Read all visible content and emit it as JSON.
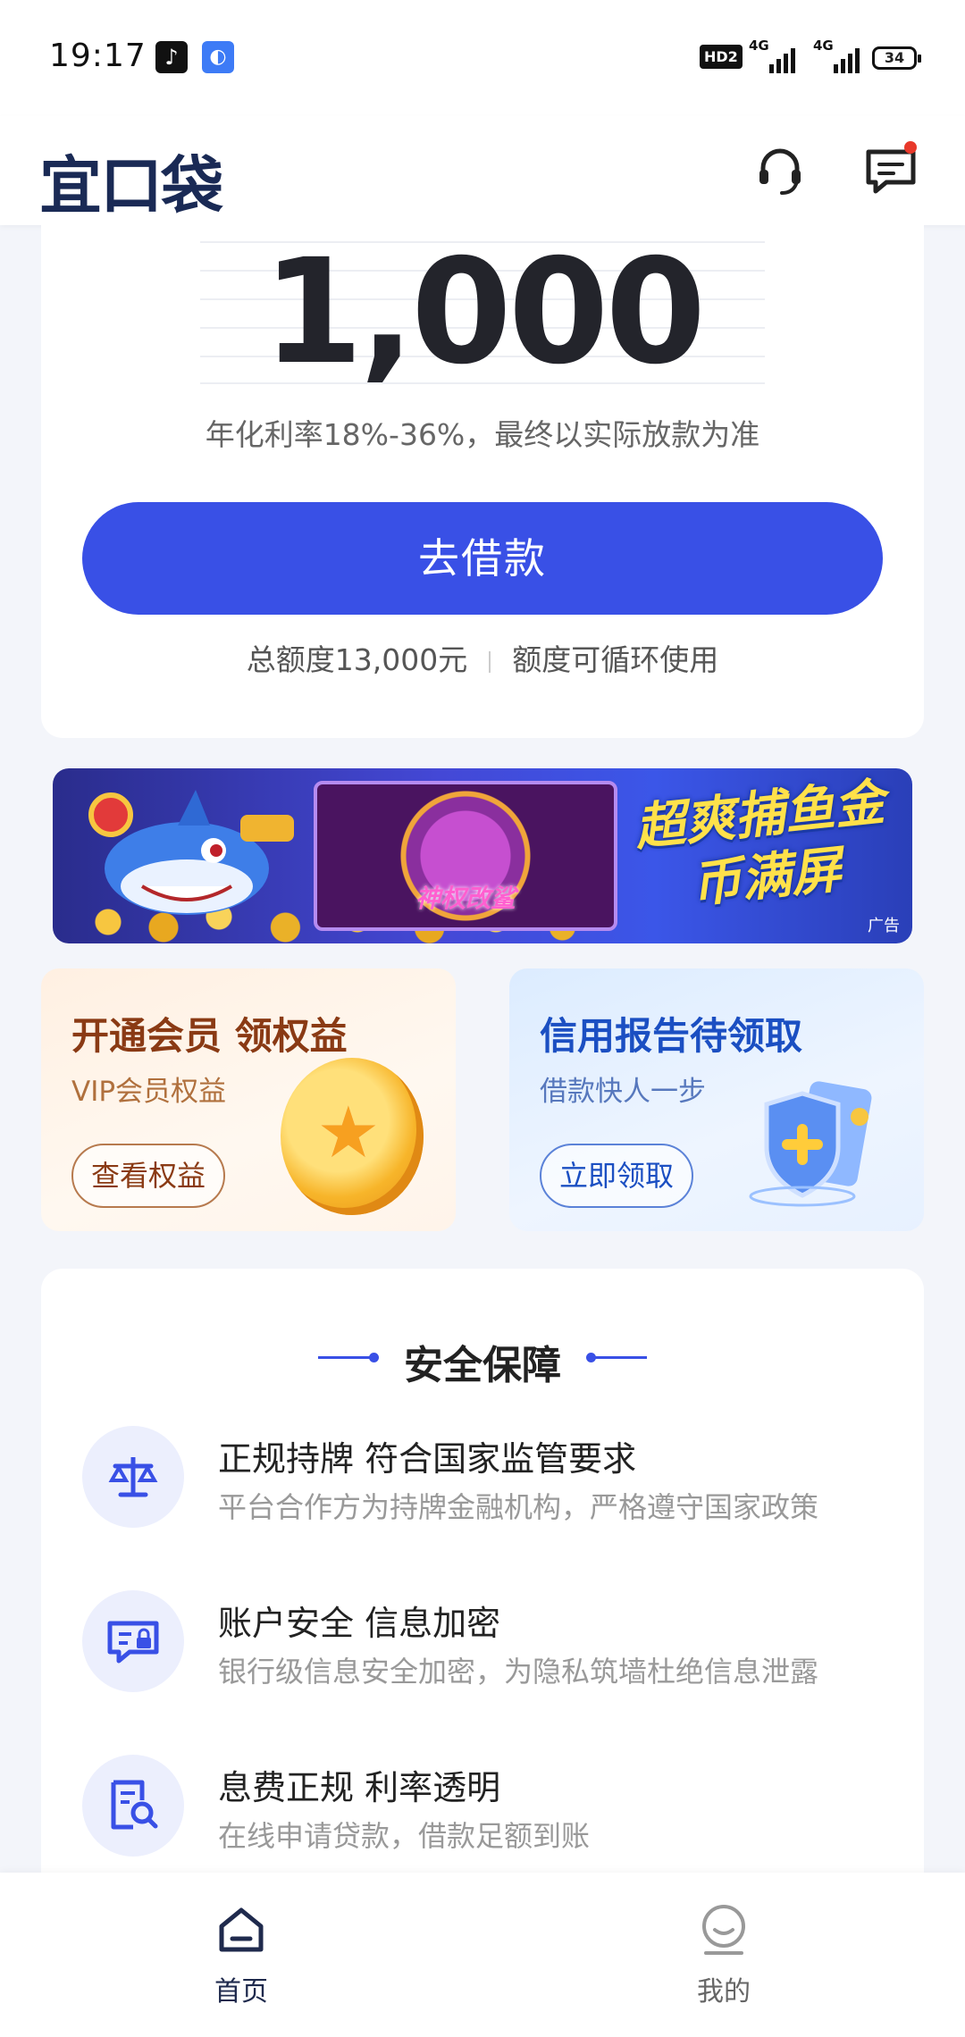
{
  "status_bar": {
    "time": "19:17",
    "hd_badge": "HD2",
    "network_1": "4G",
    "network_2": "4G",
    "battery": "34"
  },
  "header": {
    "logo": "宜口袋",
    "icons": [
      "headset-icon",
      "message-icon"
    ],
    "has_unread_dot": true
  },
  "loan": {
    "amount": "1,000",
    "rate_note": "年化利率18%-36%，最终以实际放款为准",
    "borrow_button": "去借款",
    "total_quota": "总额度13,000元",
    "quota_note": "额度可循环使用"
  },
  "ad_banner": {
    "title": "超爽捕鱼金币满屏",
    "screen_text": "神权改鲨",
    "tag": "广告"
  },
  "promos": {
    "vip": {
      "title": "开通会员 领权益",
      "subtitle": "VIP会员权益",
      "button": "查看权益"
    },
    "credit": {
      "title": "信用报告待领取",
      "subtitle": "借款快人一步",
      "button": "立即领取"
    }
  },
  "security": {
    "heading": "安全保障",
    "items": [
      {
        "title": "正规持牌 符合国家监管要求",
        "desc": "平台合作方为持牌金融机构，严格遵守国家政策",
        "icon": "scale-icon"
      },
      {
        "title": "账户安全 信息加密",
        "desc": "银行级信息安全加密，为隐私筑墙杜绝信息泄露",
        "icon": "lock-message-icon"
      },
      {
        "title": "息费正规  利率透明",
        "desc": "在线申请贷款，借款足额到账",
        "icon": "document-search-icon"
      }
    ]
  },
  "bottom_nav": {
    "home": "首页",
    "mine": "我的"
  },
  "colors": {
    "primary": "#3950e6",
    "background": "#f3f5fa",
    "vip_brown": "#8a3a14",
    "credit_blue": "#1b4fc2"
  }
}
